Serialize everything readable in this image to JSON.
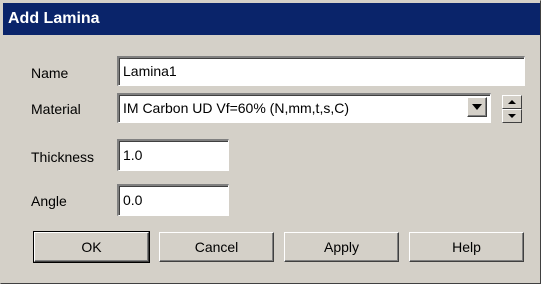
{
  "window": {
    "title": "Add Lamina"
  },
  "form": {
    "name": {
      "label": "Name",
      "value": "Lamina1"
    },
    "material": {
      "label": "Material",
      "value": "IM Carbon UD Vf=60% (N,mm,t,s,C)"
    },
    "thickness": {
      "label": "Thickness",
      "value": "1.0"
    },
    "angle": {
      "label": "Angle",
      "value": "0.0"
    }
  },
  "buttons": {
    "ok": "OK",
    "cancel": "Cancel",
    "apply": "Apply",
    "help": "Help"
  },
  "icons": {
    "combo_dropdown": "chevron-down-icon",
    "spin_up": "arrow-up-icon",
    "spin_down": "arrow-down-icon"
  }
}
